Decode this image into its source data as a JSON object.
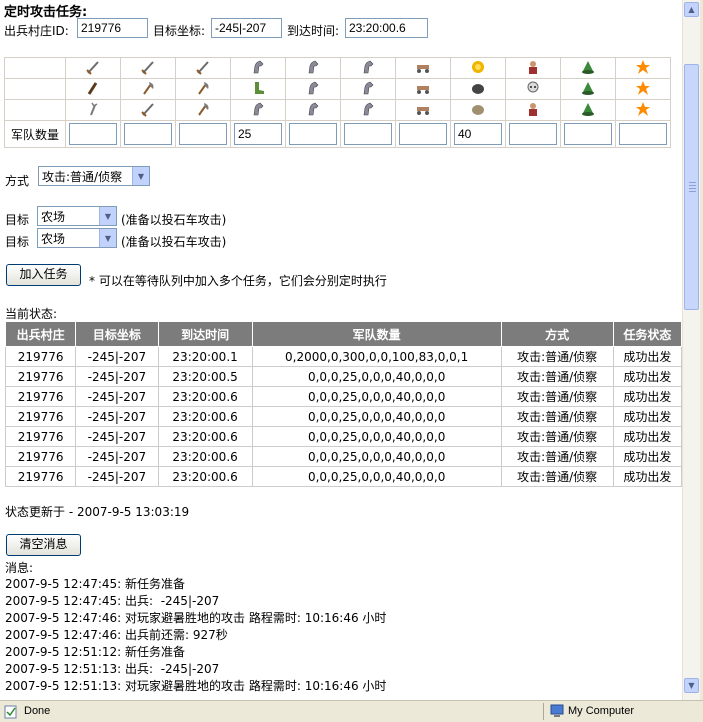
{
  "title": "定时攻击任务:",
  "form": {
    "village_label": "出兵村庄ID:",
    "village_value": "219776",
    "target_label": "目标坐标:",
    "target_value": "-245|-207",
    "arrival_label": "到达时间:",
    "arrival_value": "23:20:00.6"
  },
  "units": {
    "icon_rows": [
      [
        "sword-icon",
        "sword-icon",
        "sword-icon",
        "horse-icon",
        "horse-icon",
        "horse-icon",
        "ram-icon",
        "sun-icon",
        "chief-icon",
        "pot-icon",
        "star-icon"
      ],
      [
        "club-icon",
        "axe-icon",
        "axe-icon",
        "boot-icon",
        "horse-icon",
        "horse-icon",
        "ram-icon",
        "stone-icon",
        "ghost-icon",
        "pot-icon",
        "star-icon"
      ],
      [
        "fork-icon",
        "sword-icon",
        "axe-icon",
        "horse-icon",
        "horse-icon",
        "horse-icon",
        "ram-icon",
        "rock-icon",
        "chief-icon",
        "pot-icon",
        "star-icon"
      ]
    ],
    "count_label": "军队数量",
    "counts": [
      "",
      "",
      "",
      "25",
      "",
      "",
      "",
      "40",
      "",
      "",
      ""
    ]
  },
  "mode": {
    "label": "方式",
    "value": "攻击:普通/侦察"
  },
  "targets": [
    {
      "label": "目标",
      "value": "农场",
      "note": "(准备以投石车攻击)"
    },
    {
      "label": "目标",
      "value": "农场",
      "note": "(准备以投石车攻击)"
    }
  ],
  "add_task": {
    "label": "加入任务",
    "note": "* 可以在等待队列中加入多个任务，它们会分别定时执行"
  },
  "current_status_label": "当前状态:",
  "status_table": {
    "headers": [
      "出兵村庄",
      "目标坐标",
      "到达时间",
      "军队数量",
      "方式",
      "任务状态"
    ],
    "rows": [
      [
        "219776",
        "-245|-207",
        "23:20:00.1",
        "0,2000,0,300,0,0,100,83,0,0,1",
        "攻击:普通/侦察",
        "成功出发"
      ],
      [
        "219776",
        "-245|-207",
        "23:20:00.5",
        "0,0,0,25,0,0,0,40,0,0,0",
        "攻击:普通/侦察",
        "成功出发"
      ],
      [
        "219776",
        "-245|-207",
        "23:20:00.6",
        "0,0,0,25,0,0,0,40,0,0,0",
        "攻击:普通/侦察",
        "成功出发"
      ],
      [
        "219776",
        "-245|-207",
        "23:20:00.6",
        "0,0,0,25,0,0,0,40,0,0,0",
        "攻击:普通/侦察",
        "成功出发"
      ],
      [
        "219776",
        "-245|-207",
        "23:20:00.6",
        "0,0,0,25,0,0,0,40,0,0,0",
        "攻击:普通/侦察",
        "成功出发"
      ],
      [
        "219776",
        "-245|-207",
        "23:20:00.6",
        "0,0,0,25,0,0,0,40,0,0,0",
        "攻击:普通/侦察",
        "成功出发"
      ],
      [
        "219776",
        "-245|-207",
        "23:20:00.6",
        "0,0,0,25,0,0,0,40,0,0,0",
        "攻击:普通/侦察",
        "成功出发"
      ]
    ]
  },
  "updated": "状态更新于 - 2007-9-5 13:03:19",
  "clear_button": "清空消息",
  "messages_label": "消息:",
  "messages": [
    "2007-9-5 12:47:45: 新任务准备",
    "2007-9-5 12:47:45: 出兵:  -245|-207",
    "2007-9-5 12:47:46: 对玩家避暑胜地的攻击 路程需时: 10:16:46 小时",
    "2007-9-5 12:47:46: 出兵前还需: 927秒",
    "2007-9-5 12:51:12: 新任务准备",
    "2007-9-5 12:51:13: 出兵:  -245|-207",
    "2007-9-5 12:51:13: 对玩家避暑胜地的攻击 路程需时: 10:16:46 小时"
  ],
  "statusbar": {
    "left": "Done",
    "right": "My Computer"
  },
  "colors": {
    "header_bg": "#7c7c7c",
    "input_border": "#7f9db9",
    "button_border": "#003c74"
  }
}
